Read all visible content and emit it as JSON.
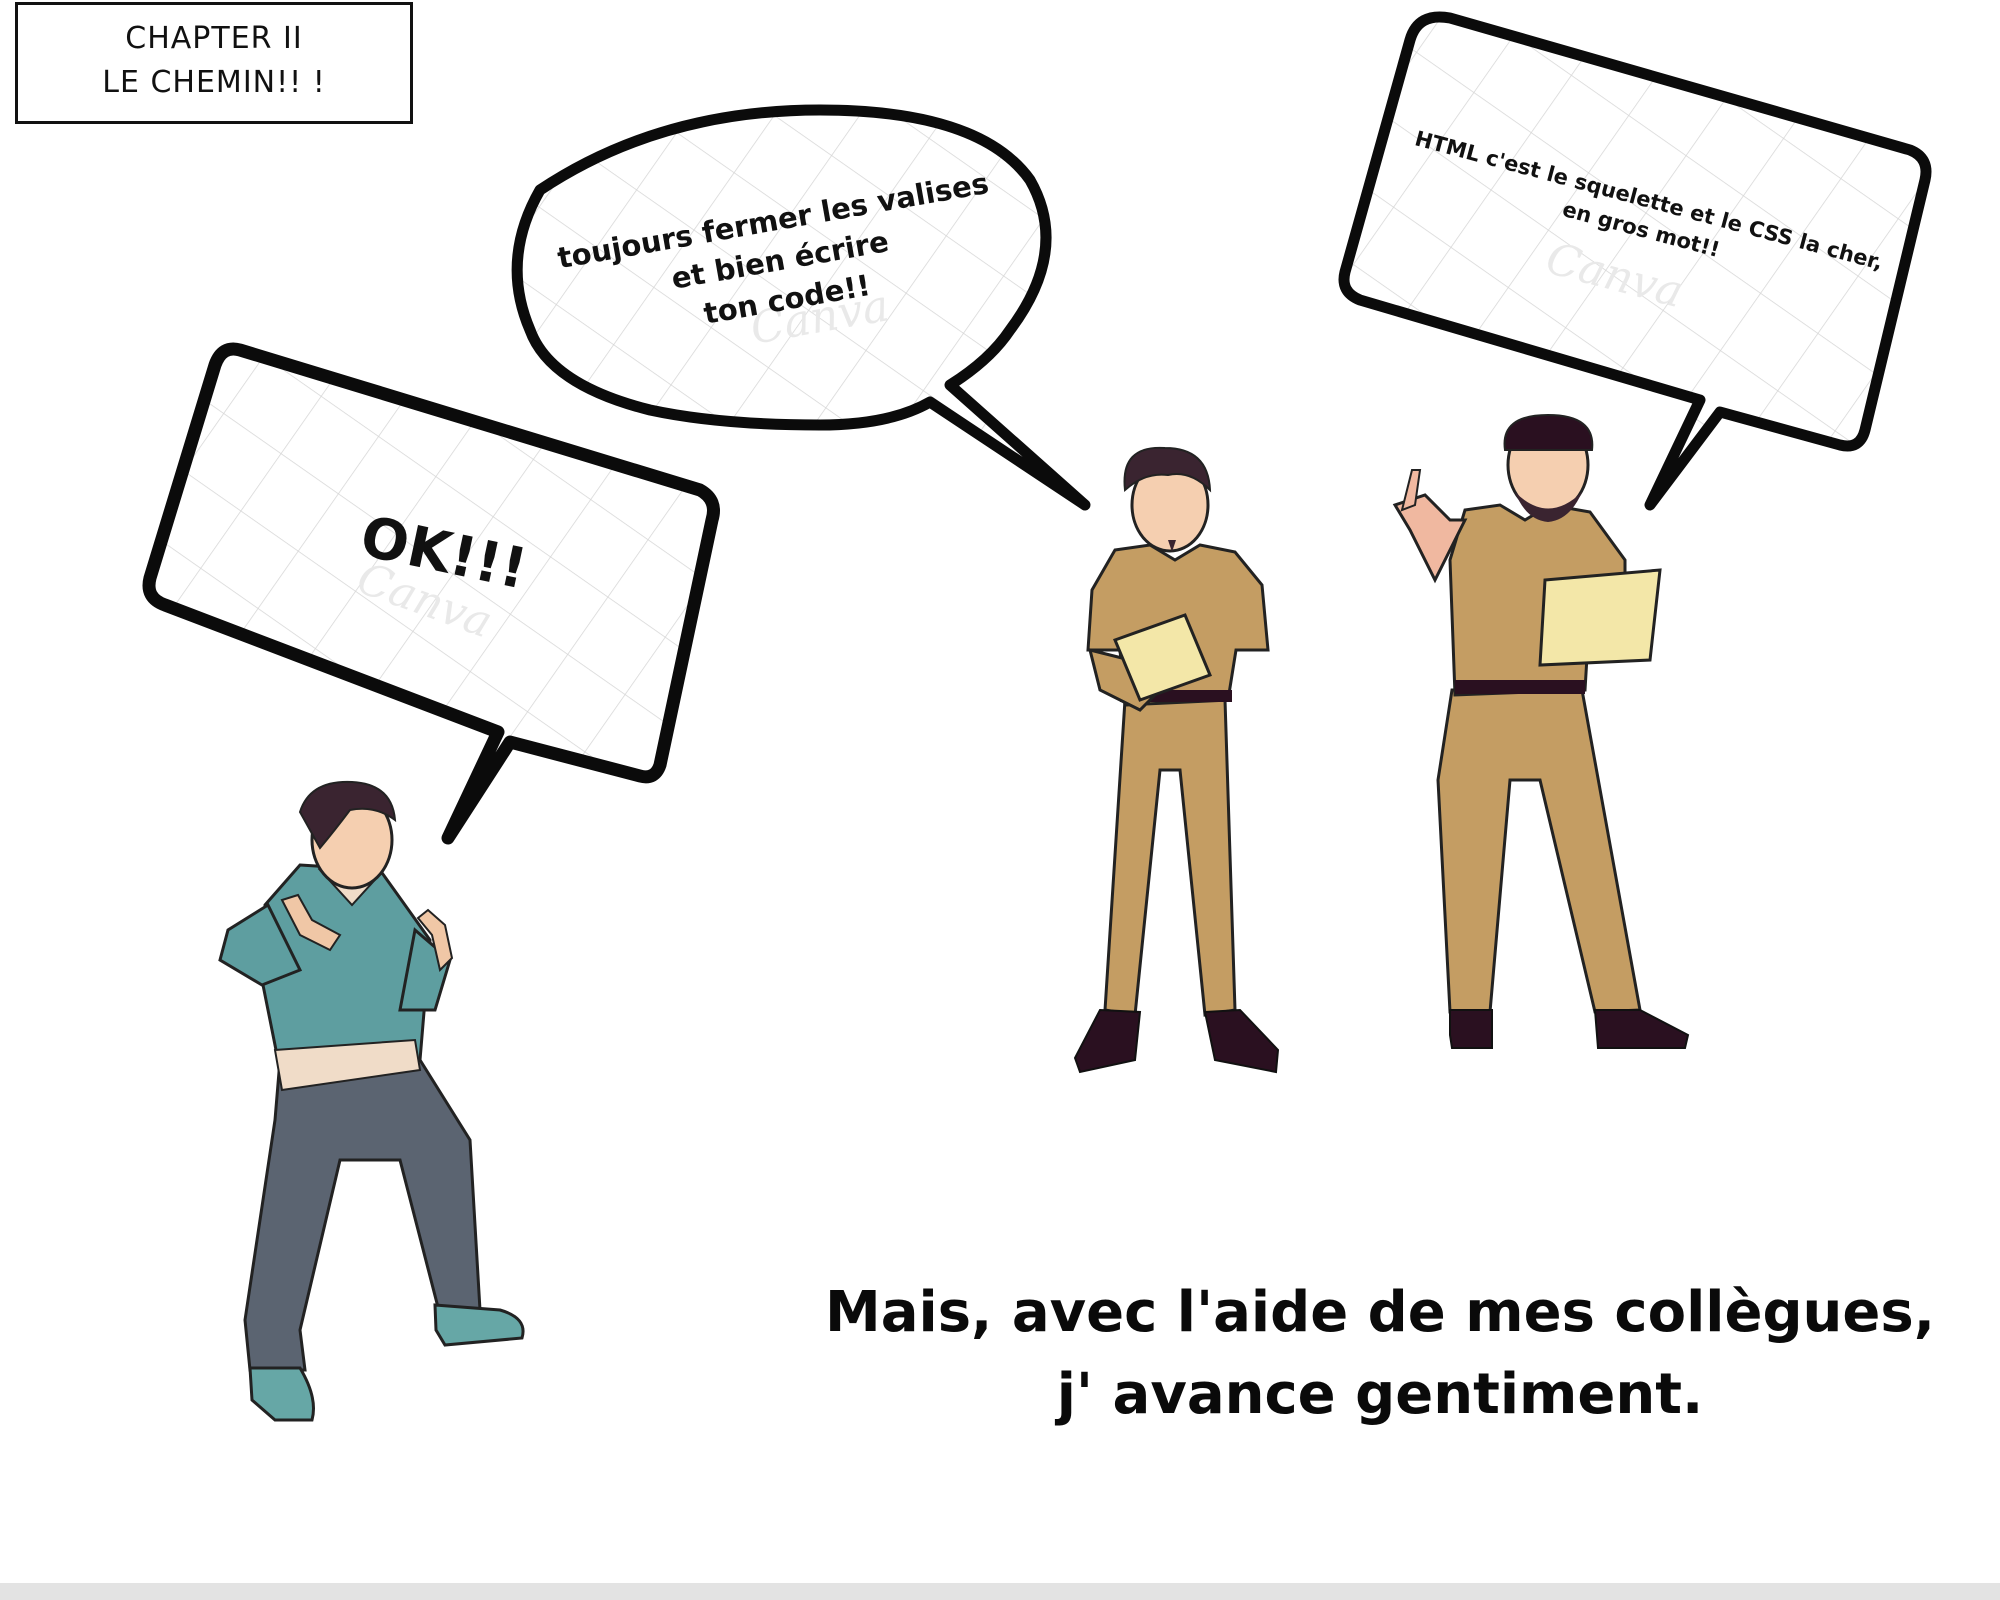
{
  "chapter": {
    "line1": "CHAPTER II",
    "line2": "LE CHEMIN!! !"
  },
  "bubbles": {
    "left": {
      "text": "OK!!!"
    },
    "middle": {
      "lines": [
        "toujours fermer les valises",
        "et bien écrire",
        "ton code!!"
      ]
    },
    "right": {
      "lines": [
        "HTML c'est le squelette et le CSS la cher,",
        "en gros mot!!"
      ]
    }
  },
  "caption": {
    "line1": "Mais, avec l'aide de mes collègues,",
    "line2": "j' avance gentiment."
  },
  "watermark": "Canva",
  "colors": {
    "uniform": "#c49d63",
    "teal_sweater": "#5e9ea0",
    "trousers": "#5b6471",
    "hair": "#3a2430",
    "shoes": "#2a1020",
    "book": "#f3e7a8"
  }
}
